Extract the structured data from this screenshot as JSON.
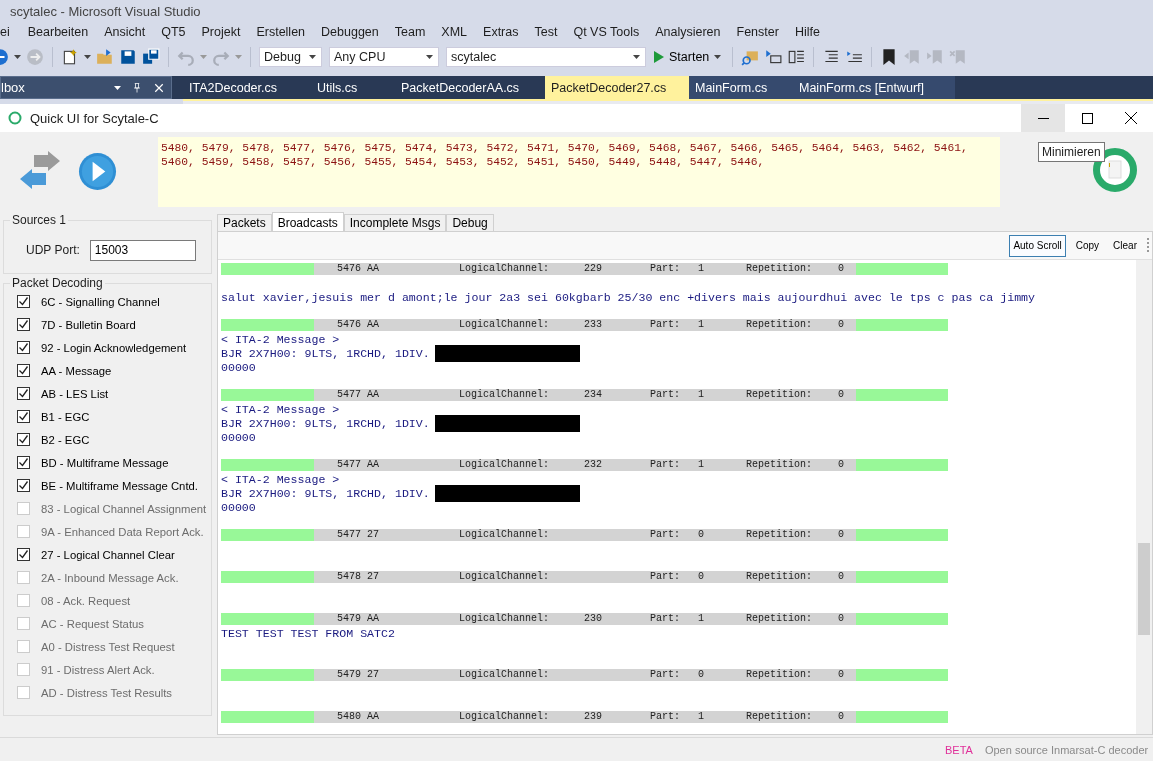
{
  "vs_window": {
    "title": "scytalec - Microsoft Visual Studio"
  },
  "menu": [
    "ei",
    "Bearbeiten",
    "Ansicht",
    "QT5",
    "Projekt",
    "Erstellen",
    "Debuggen",
    "Team",
    "XML",
    "Extras",
    "Test",
    "Qt VS Tools",
    "Analysieren",
    "Fenster",
    "Hilfe"
  ],
  "toolbar": {
    "configuration": "Debug",
    "platform": "Any CPU",
    "project": "scytalec",
    "start_label": "Starten"
  },
  "tool_panel": {
    "title": "lbox"
  },
  "doc_tabs": [
    {
      "label": "ITA2Decoder.cs",
      "selected": false
    },
    {
      "label": "Utils.cs",
      "selected": false
    },
    {
      "label": "PacketDecoderAA.cs",
      "selected": false
    },
    {
      "label": "PacketDecoder27.cs",
      "selected": true
    },
    {
      "label": "MainForm.cs",
      "selected": false
    },
    {
      "label": "MainForm.cs [Entwurf]",
      "selected": false
    }
  ],
  "app_window": {
    "title": "Quick UI for Scytale-C",
    "tooltip": "Minimieren"
  },
  "frame_list": {
    "lines": [
      "5480, 5479, 5478, 5477, 5476, 5475, 5474, 5473, 5472, 5471, 5470, 5469, 5468, 5467, 5466, 5465, 5464, 5463, 5462, 5461,",
      "5460, 5459, 5458, 5457, 5456, 5455, 5454, 5453, 5452, 5451, 5450, 5449, 5448, 5447, 5446,"
    ]
  },
  "sources": {
    "title": "Sources 1",
    "port_label": "UDP Port:",
    "port": "15003"
  },
  "packet_decoding": {
    "title": "Packet Decoding",
    "items": [
      {
        "label": "6C - Signalling Channel",
        "checked": true
      },
      {
        "label": "7D - Bulletin Board",
        "checked": true
      },
      {
        "label": "92 - Login Acknowledgement",
        "checked": true
      },
      {
        "label": "AA - Message",
        "checked": true
      },
      {
        "label": "AB - LES List",
        "checked": true
      },
      {
        "label": "B1 - EGC",
        "checked": true
      },
      {
        "label": "B2 - EGC",
        "checked": true
      },
      {
        "label": "BD - Multiframe Message",
        "checked": true
      },
      {
        "label": "BE - Multiframe Message Cntd.",
        "checked": true
      },
      {
        "label": "83 - Logical Channel Assignment",
        "checked": false
      },
      {
        "label": "9A - Enhanced Data Report Ack.",
        "checked": false
      },
      {
        "label": "27 - Logical Channel Clear",
        "checked": true
      },
      {
        "label": "2A - Inbound Message Ack.",
        "checked": false
      },
      {
        "label": "08 - Ack. Request",
        "checked": false
      },
      {
        "label": "AC - Request Status",
        "checked": false
      },
      {
        "label": "A0 - Distress Test Request",
        "checked": false
      },
      {
        "label": "91 - Distress Alert Ack.",
        "checked": false
      },
      {
        "label": "AD - Distress Test Results",
        "checked": false
      }
    ]
  },
  "tabs": [
    {
      "label": "Packets",
      "selected": false
    },
    {
      "label": "Broadcasts",
      "selected": true
    },
    {
      "label": "Incomplete Msgs",
      "selected": false
    },
    {
      "label": "Debug",
      "selected": false
    }
  ],
  "log_toolbar": {
    "buttons": [
      {
        "label": "Auto Scroll",
        "selected": true
      },
      {
        "label": "Copy",
        "selected": false
      },
      {
        "label": "Clear",
        "selected": false
      }
    ]
  },
  "log": [
    {
      "kind": "header",
      "packet": "5476 AA",
      "channel_label": "LogicalChannel:",
      "channel": "229",
      "part_label": "Part:",
      "part": "1",
      "repetition_label": "Repetition:",
      "repetition": "0"
    },
    {
      "kind": "blank"
    },
    {
      "kind": "text",
      "text": "salut xavier,jesuis mer d amont;le jour 2a3 sei 60kgbarb 25/30 enc +divers mais aujourdhui avec le tps c pas ca jimmy"
    },
    {
      "kind": "blank"
    },
    {
      "kind": "header",
      "packet": "5476 AA",
      "channel_label": "LogicalChannel:",
      "channel": "233",
      "part_label": "Part:",
      "part": "1",
      "repetition_label": "Repetition:",
      "repetition": "0"
    },
    {
      "kind": "text",
      "text": "< ITA-2 Message >"
    },
    {
      "kind": "text",
      "text": "BJR 2X7H00: 9LTS, 1RCHD, 1DIV.",
      "redacted": true
    },
    {
      "kind": "text",
      "text": "00000"
    },
    {
      "kind": "blank"
    },
    {
      "kind": "header",
      "packet": "5477 AA",
      "channel_label": "LogicalChannel:",
      "channel": "234",
      "part_label": "Part:",
      "part": "1",
      "repetition_label": "Repetition:",
      "repetition": "0"
    },
    {
      "kind": "text",
      "text": "< ITA-2 Message >"
    },
    {
      "kind": "text",
      "text": "BJR 2X7H00: 9LTS, 1RCHD, 1DIV.",
      "redacted": true
    },
    {
      "kind": "text",
      "text": "00000"
    },
    {
      "kind": "blank"
    },
    {
      "kind": "header",
      "packet": "5477 AA",
      "channel_label": "LogicalChannel:",
      "channel": "232",
      "part_label": "Part:",
      "part": "1",
      "repetition_label": "Repetition:",
      "repetition": "0"
    },
    {
      "kind": "text",
      "text": "< ITA-2 Message >"
    },
    {
      "kind": "text",
      "text": "BJR 2X7H00: 9LTS, 1RCHD, 1DIV.",
      "redacted": true
    },
    {
      "kind": "text",
      "text": "00000"
    },
    {
      "kind": "blank"
    },
    {
      "kind": "header",
      "packet": "5477 27",
      "channel_label": "LogicalChannel:",
      "part_label": "Part:",
      "part": "0",
      "repetition_label": "Repetition:",
      "repetition": "0"
    },
    {
      "kind": "blank"
    },
    {
      "kind": "blank"
    },
    {
      "kind": "header",
      "packet": "5478 27",
      "channel_label": "LogicalChannel:",
      "part_label": "Part:",
      "part": "0",
      "repetition_label": "Repetition:",
      "repetition": "0"
    },
    {
      "kind": "blank"
    },
    {
      "kind": "blank"
    },
    {
      "kind": "header",
      "packet": "5479 AA",
      "channel_label": "LogicalChannel:",
      "channel": "230",
      "part_label": "Part:",
      "part": "1",
      "repetition_label": "Repetition:",
      "repetition": "0"
    },
    {
      "kind": "text",
      "text": "TEST TEST TEST FROM SATC2"
    },
    {
      "kind": "blank"
    },
    {
      "kind": "blank"
    },
    {
      "kind": "header",
      "packet": "5479 27",
      "channel_label": "LogicalChannel:",
      "part_label": "Part:",
      "part": "0",
      "repetition_label": "Repetition:",
      "repetition": "0"
    },
    {
      "kind": "blank"
    },
    {
      "kind": "blank"
    },
    {
      "kind": "header",
      "packet": "5480 AA",
      "channel_label": "LogicalChannel:",
      "channel": "239",
      "part_label": "Part:",
      "part": "1",
      "repetition_label": "Repetition:",
      "repetition": "0"
    }
  ],
  "status_bar": {
    "badge": "BETA",
    "description": "Open source Inmarsat-C decoder"
  }
}
